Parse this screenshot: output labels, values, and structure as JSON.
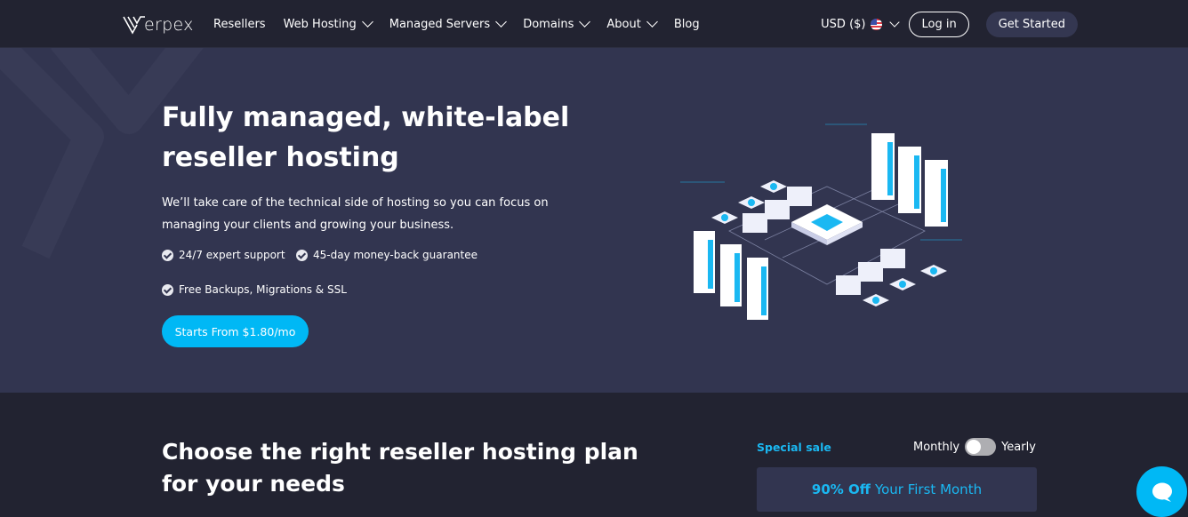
{
  "nav": {
    "logo_text": "erpex",
    "items": [
      {
        "label": "Resellers",
        "has_dropdown": false
      },
      {
        "label": "Web Hosting",
        "has_dropdown": true
      },
      {
        "label": "Managed Servers",
        "has_dropdown": true
      },
      {
        "label": "Domains",
        "has_dropdown": true
      },
      {
        "label": "About",
        "has_dropdown": true
      },
      {
        "label": "Blog",
        "has_dropdown": false
      }
    ],
    "currency": "USD ($)",
    "currency_flag": "us-flag-icon",
    "login_label": "Log in",
    "get_started_label": "Get Started"
  },
  "hero": {
    "title": "Fully managed, white-label reseller hosting",
    "description": "We’ll take care of the technical side of hosting so you can focus on managing your clients and growing your business.",
    "features": [
      "24/7 expert support",
      "45-day money-back guarantee",
      "Free Backups, Migrations & SSL"
    ],
    "cta_label": "Starts From $1.80/mo"
  },
  "plans": {
    "title": "Choose the right reseller hosting plan for your needs",
    "special_label": "Special sale",
    "billing_monthly": "Monthly",
    "billing_yearly": "Yearly",
    "billing_toggle_yearly": false,
    "promo_bold": "90% Off",
    "promo_rest": "Your First Month"
  },
  "colors": {
    "accent": "#00b8f5",
    "nav_bg": "#222331",
    "hero_bg": "#323550"
  }
}
